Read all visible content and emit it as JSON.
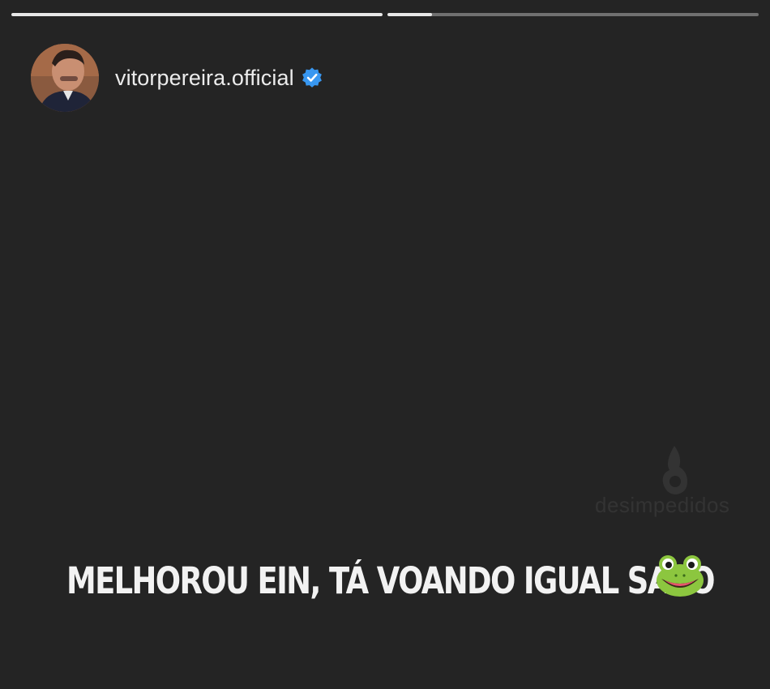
{
  "story": {
    "progress": [
      1.0,
      0.12
    ],
    "username": "vitorpereira.official",
    "verified_icon": "verified-badge-icon",
    "avatar_icon": "profile-avatar",
    "caption": "MELHOROU EIN, TÁ VOANDO IGUAL SAPO",
    "caption_emoji": "frog-face-icon",
    "watermark": "desimpedidos"
  },
  "colors": {
    "background": "#242424",
    "verified_badge": "#3897f0",
    "text": "#f2f2f2"
  }
}
